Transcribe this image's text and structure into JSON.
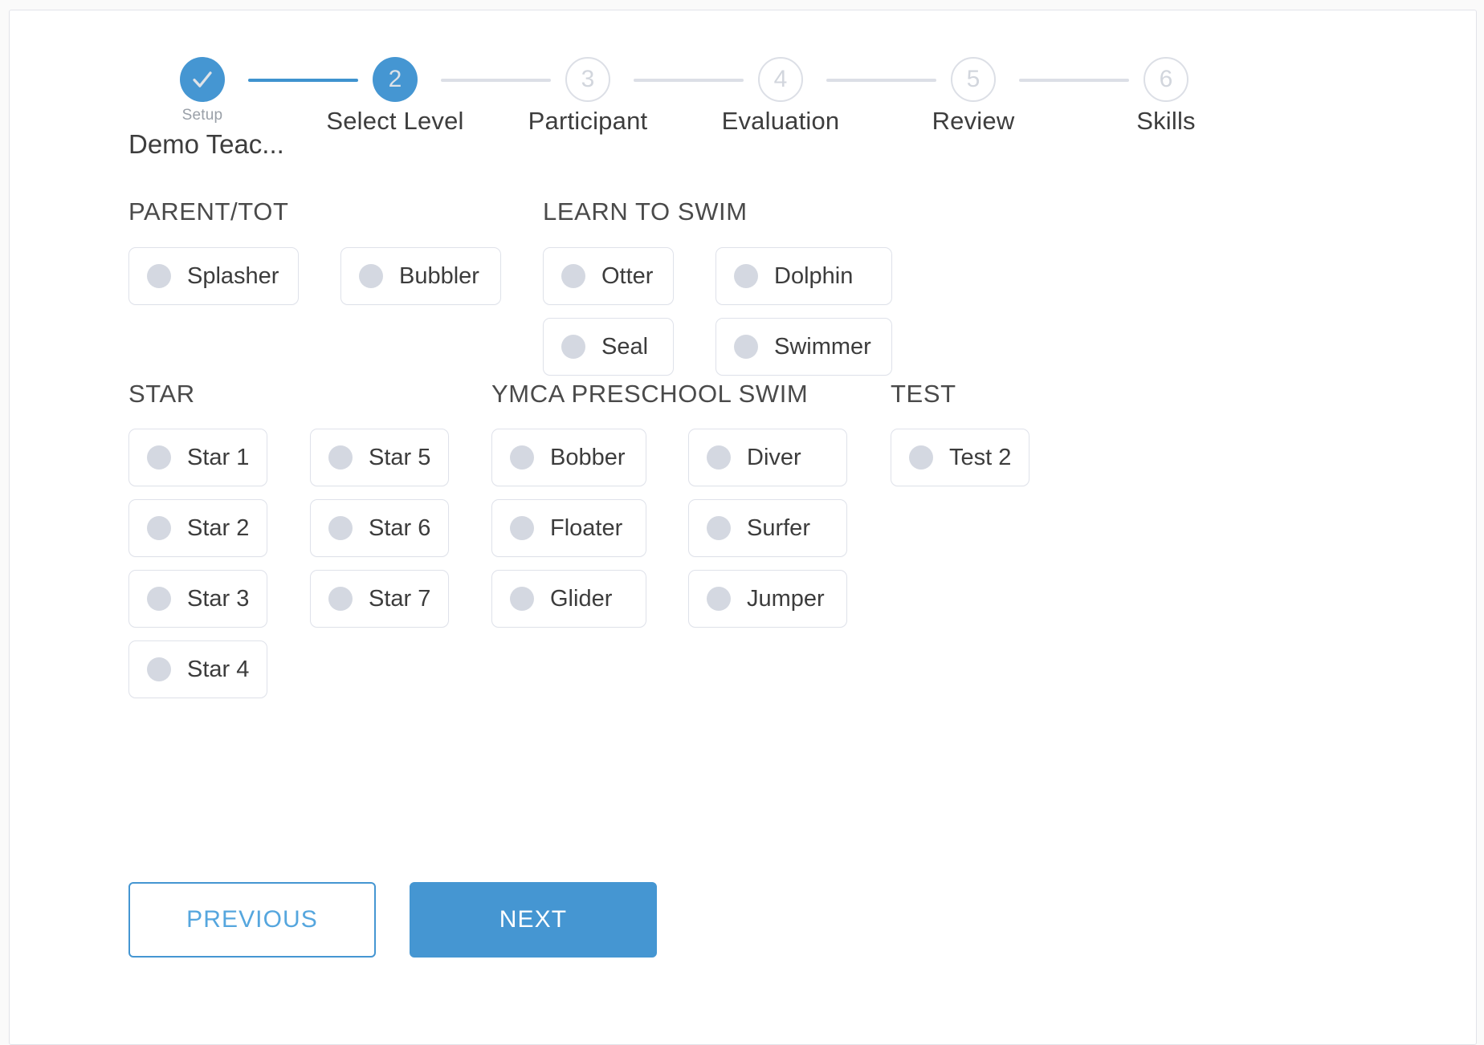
{
  "stepper": {
    "steps": [
      {
        "number": "1",
        "label": "Setup",
        "state": "done",
        "icon": "check-icon"
      },
      {
        "number": "2",
        "label": "Select Level",
        "state": "active"
      },
      {
        "number": "3",
        "label": "Participant",
        "state": "pending"
      },
      {
        "number": "4",
        "label": "Evaluation",
        "state": "pending"
      },
      {
        "number": "5",
        "label": "Review",
        "state": "pending"
      },
      {
        "number": "6",
        "label": "Skills",
        "state": "pending"
      }
    ],
    "setup_name": "Demo Teac...",
    "accent_color": "#4596d2",
    "pending_color": "#dcdfe6"
  },
  "sections": [
    {
      "title": "PARENT/TOT"
    },
    {
      "title": "LEARN TO SWIM"
    },
    {
      "title": "STAR"
    },
    {
      "title": "YMCA PRESCHOOL SWIM"
    },
    {
      "title": "TEST"
    }
  ],
  "levels": {
    "parent_tot": [
      "Splasher",
      "Bubbler"
    ],
    "learn_to_swim": [
      "Otter",
      "Dolphin",
      "Seal",
      "Swimmer"
    ],
    "star": [
      "Star 1",
      "Star 2",
      "Star 3",
      "Star 4",
      "Star 5",
      "Star 6",
      "Star 7"
    ],
    "ymca_preschool_swim": [
      "Bobber",
      "Floater",
      "Glider",
      "Diver",
      "Surfer",
      "Jumper"
    ],
    "test": [
      "Test 2"
    ]
  },
  "footer": {
    "previous_label": "PREVIOUS",
    "next_label": "NEXT"
  }
}
